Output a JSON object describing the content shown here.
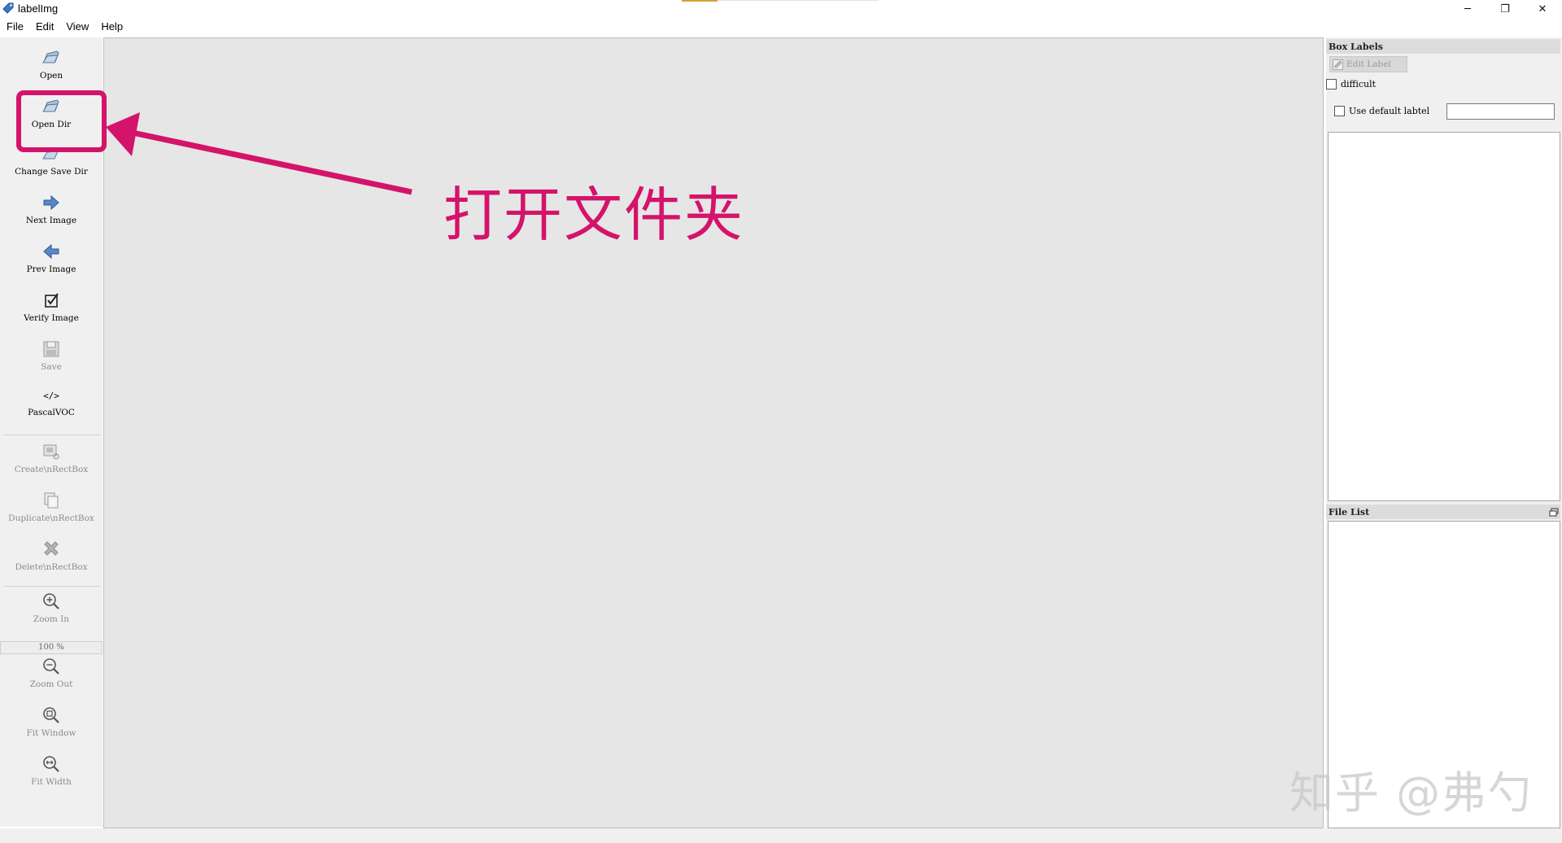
{
  "window": {
    "title": "labelImg",
    "controls": {
      "minimize": "─",
      "restore": "❐",
      "close": "✕"
    }
  },
  "menu": [
    "File",
    "Edit",
    "View",
    "Help"
  ],
  "toolbar": {
    "open": "Open",
    "open_dir": "Open Dir",
    "change_save_dir": "Change Save Dir",
    "next_image": "Next Image",
    "prev_image": "Prev Image",
    "verify_image": "Verify Image",
    "save": "Save",
    "format_icon_text": "</>",
    "format": "PascalVOC",
    "create_rectbox": "Create\\nRectBox",
    "duplicate_rectbox": "Duplicate\\nRectBox",
    "delete_rectbox": "Delete\\nRectBox",
    "zoom_in": "Zoom In",
    "zoom_level": "100 %",
    "zoom_out": "Zoom Out",
    "fit_window": "Fit Window",
    "fit_width": "Fit Width"
  },
  "box_labels": {
    "title": "Box Labels",
    "edit_label": "Edit Label",
    "difficult": "difficult",
    "use_default_label": "Use default labtel",
    "default_label_value": ""
  },
  "file_list": {
    "title": "File List"
  },
  "annotation": {
    "text": "打开文件夹",
    "color": "#d4136b"
  },
  "watermark": "知乎 @弗勺"
}
